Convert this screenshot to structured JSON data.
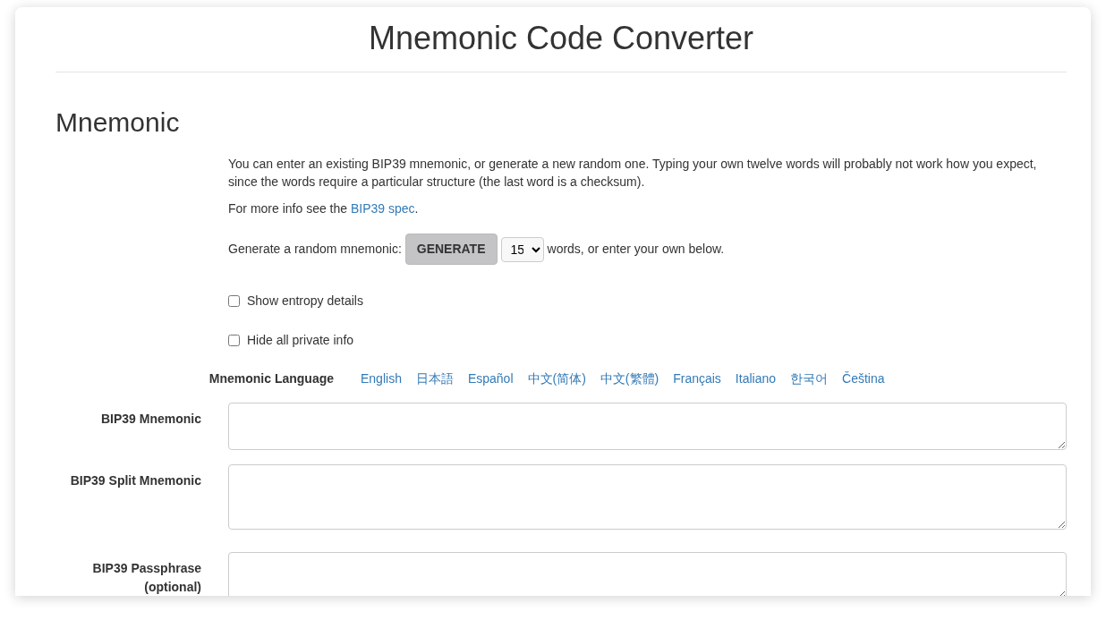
{
  "title": "Mnemonic Code Converter",
  "section": "Mnemonic",
  "intro": [
    "You can enter an existing BIP39 mnemonic, or generate a new random one. Typing your own twelve words will probably not work how you expect, since the words require a particular structure (the last word is a checksum)."
  ],
  "more_info": {
    "before": "For more info see the ",
    "link": "BIP39 spec",
    "after": "."
  },
  "generate": {
    "label": "Generate a random mnemonic:",
    "button": "GENERATE",
    "words": "15",
    "suffix": "words, or enter your own below."
  },
  "options": [
    {
      "label": "Show entropy details",
      "checked": false
    },
    {
      "label": "Hide all private info",
      "checked": false
    }
  ],
  "language": {
    "label": "Mnemonic Language",
    "items": [
      "English",
      "日本語",
      "Español",
      "中文(简体)",
      "中文(繁體)",
      "Français",
      "Italiano",
      "한국어",
      "Čeština"
    ]
  },
  "fields": [
    {
      "label": "BIP39 Mnemonic"
    },
    {
      "label": "BIP39 Split Mnemonic"
    },
    {
      "label": "BIP39 Passphrase (optional)"
    }
  ]
}
